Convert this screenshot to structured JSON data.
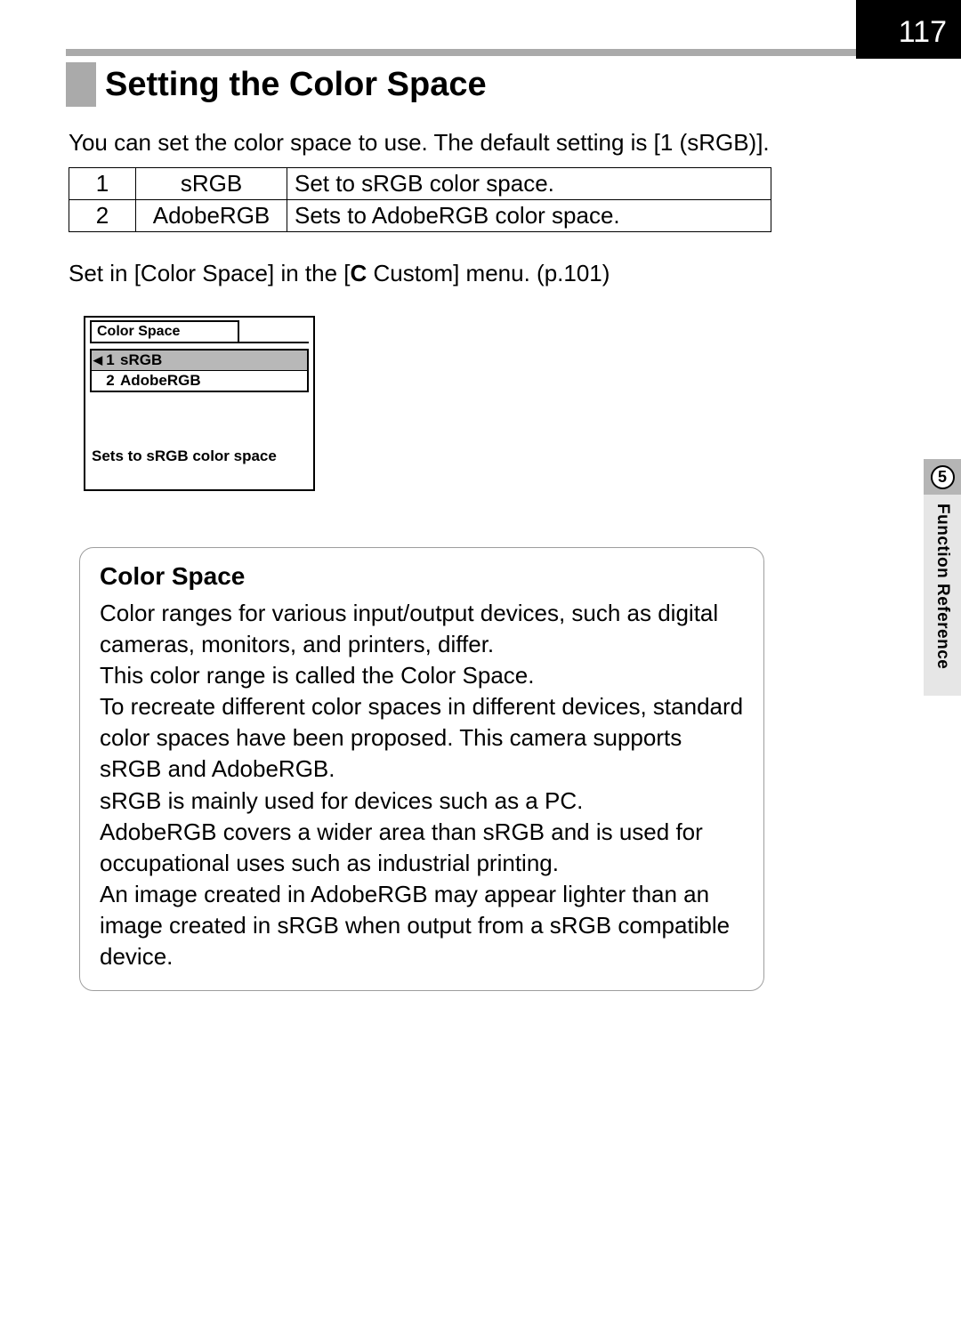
{
  "page_number": "117",
  "heading": "Setting the Color Space",
  "intro": "You can set the color space to use. The default setting is [1 (sRGB)].",
  "options": [
    {
      "num": "1",
      "name": "sRGB",
      "desc": "Set to sRGB color space."
    },
    {
      "num": "2",
      "name": "AdobeRGB",
      "desc": "Sets to AdobeRGB color space."
    }
  ],
  "setin": {
    "before": "Set in [Color Space] in the [",
    "icon": "C",
    "after": " Custom] menu. (p.101)"
  },
  "menu": {
    "title": "Color Space",
    "items": [
      {
        "num": "1",
        "label": "sRGB",
        "selected": true
      },
      {
        "num": "2",
        "label": "AdobeRGB",
        "selected": false
      }
    ],
    "help": "Sets to sRGB color space"
  },
  "info": {
    "title": "Color Space",
    "body": "Color ranges for various input/output devices, such as digital cameras, monitors, and printers, differ.\nThis color range is called the Color Space.\nTo recreate different color spaces in different devices, standard color spaces have been proposed. This camera supports sRGB and AdobeRGB.\nsRGB is mainly used for devices such as a PC.\nAdobeRGB covers a wider area than sRGB and is used for occupational uses such as industrial printing.\nAn image created in AdobeRGB may appear lighter than an image created in sRGB when output from a sRGB compatible device."
  },
  "side": {
    "chapter": "5",
    "label": "Function Reference"
  }
}
